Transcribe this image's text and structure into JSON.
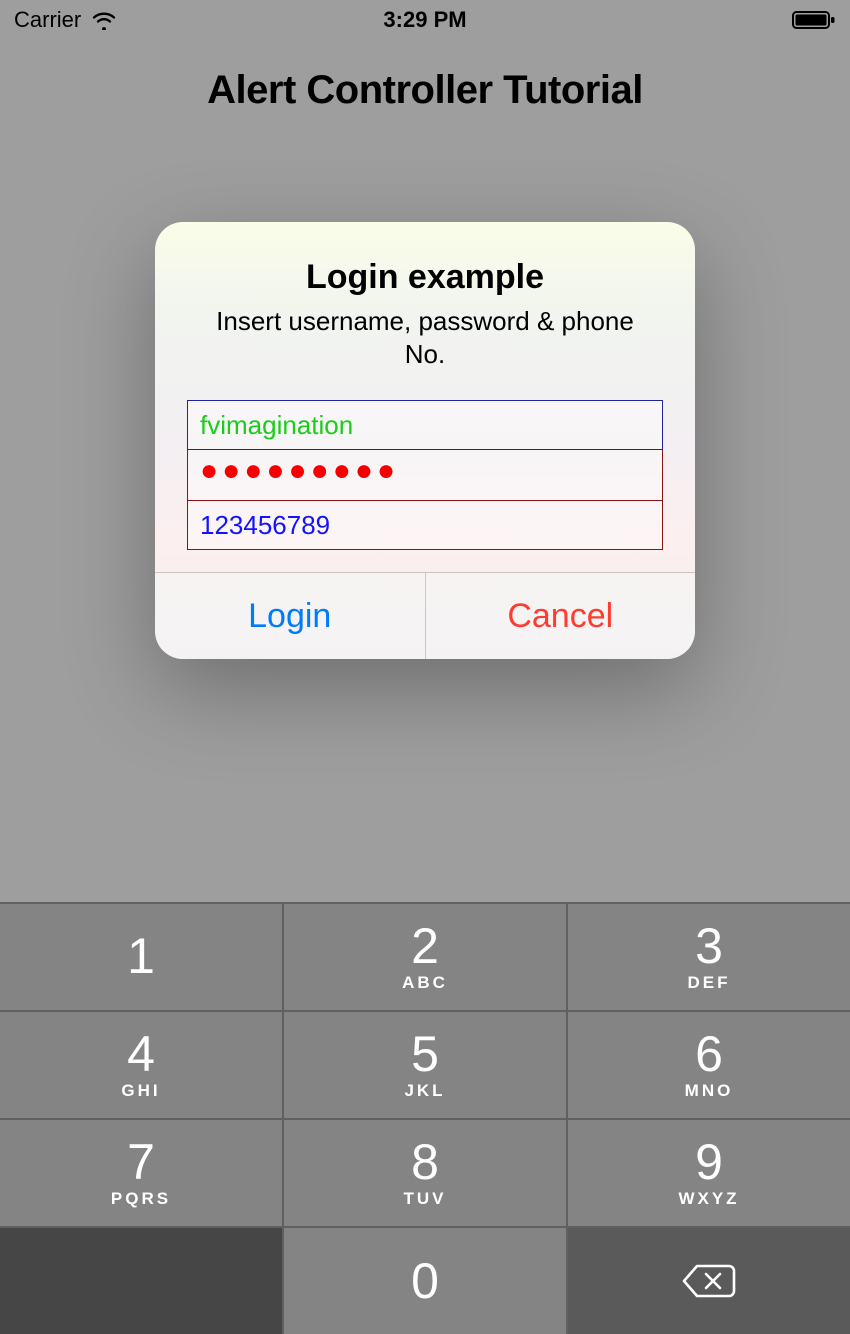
{
  "statusbar": {
    "carrier": "Carrier",
    "wifi_icon": "wifi-icon",
    "time": "3:29 PM",
    "battery_icon": "battery-full-icon"
  },
  "page": {
    "title": "Alert Controller Tutorial"
  },
  "alert": {
    "title": "Login example",
    "message": "Insert username, password & phone No.",
    "fields": {
      "username": {
        "value": "fvimagination"
      },
      "password": {
        "display": "●●●●●●●●●"
      },
      "phone": {
        "value": "123456789"
      }
    },
    "actions": {
      "login": "Login",
      "cancel": "Cancel"
    }
  },
  "keypad": {
    "rows": [
      [
        {
          "digit": "1",
          "letters": ""
        },
        {
          "digit": "2",
          "letters": "ABC"
        },
        {
          "digit": "3",
          "letters": "DEF"
        }
      ],
      [
        {
          "digit": "4",
          "letters": "GHI"
        },
        {
          "digit": "5",
          "letters": "JKL"
        },
        {
          "digit": "6",
          "letters": "MNO"
        }
      ],
      [
        {
          "digit": "7",
          "letters": "PQRS"
        },
        {
          "digit": "8",
          "letters": "TUV"
        },
        {
          "digit": "9",
          "letters": "WXYZ"
        }
      ]
    ],
    "zero": "0",
    "backspace_icon": "backspace-icon"
  }
}
